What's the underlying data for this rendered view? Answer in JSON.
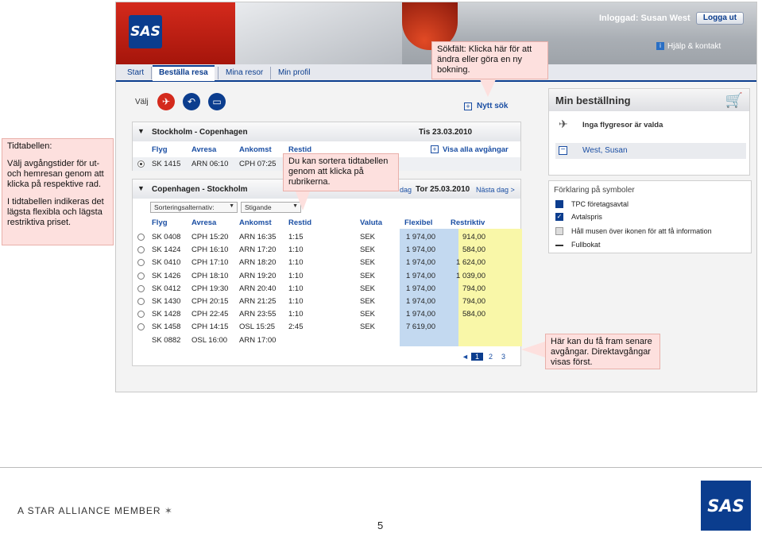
{
  "header": {
    "logo_text": "SAS",
    "user_label": "Inloggad: Susan West",
    "logout_label": "Logga ut",
    "help_label": "Hjälp & kontakt"
  },
  "tabs": [
    "Start",
    "Beställa resa",
    "Mina resor",
    "Min profil"
  ],
  "search": {
    "valj_label": "Välj",
    "new_search_label": "Nytt sök"
  },
  "outbound": {
    "route": "Stockholm - Copenhagen",
    "date": "Tis 23.03.2010",
    "columns": [
      "Flyg",
      "Avresa",
      "Ankomst",
      "Restid"
    ],
    "show_all_label": "Visa alla avgångar",
    "row": {
      "flight": "SK 1415",
      "dep": "ARN 06:10",
      "arr": "CPH 07:25"
    }
  },
  "inbound": {
    "route": "Copenhagen - Stockholm",
    "prev_day": "dag",
    "date": "Tor 25.03.2010",
    "next_day": "Nästa dag >",
    "sort_label": "Sorteringsalternativ:",
    "sort_order": "Stigande",
    "columns": [
      "Flyg",
      "Avresa",
      "Ankomst",
      "Restid",
      "Valuta",
      "Flexibel",
      "Restriktiv"
    ],
    "rows": [
      {
        "flight": "SK 0408",
        "dep": "CPH 15:20",
        "arr": "ARN 16:35",
        "dur": "1:15",
        "cur": "SEK",
        "flex": "1 974,00",
        "restr": "914,00"
      },
      {
        "flight": "SK 1424",
        "dep": "CPH 16:10",
        "arr": "ARN 17:20",
        "dur": "1:10",
        "cur": "SEK",
        "flex": "1 974,00",
        "restr": "584,00"
      },
      {
        "flight": "SK 0410",
        "dep": "CPH 17:10",
        "arr": "ARN 18:20",
        "dur": "1:10",
        "cur": "SEK",
        "flex": "1 974,00",
        "restr": "1 624,00"
      },
      {
        "flight": "SK 1426",
        "dep": "CPH 18:10",
        "arr": "ARN 19:20",
        "dur": "1:10",
        "cur": "SEK",
        "flex": "1 974,00",
        "restr": "1 039,00"
      },
      {
        "flight": "SK 0412",
        "dep": "CPH 19:30",
        "arr": "ARN 20:40",
        "dur": "1:10",
        "cur": "SEK",
        "flex": "1 974,00",
        "restr": "794,00"
      },
      {
        "flight": "SK 1430",
        "dep": "CPH 20:15",
        "arr": "ARN 21:25",
        "dur": "1:10",
        "cur": "SEK",
        "flex": "1 974,00",
        "restr": "794,00"
      },
      {
        "flight": "SK 1428",
        "dep": "CPH 22:45",
        "arr": "ARN 23:55",
        "dur": "1:10",
        "cur": "SEK",
        "flex": "1 974,00",
        "restr": "584,00"
      },
      {
        "flight": "SK 1458",
        "dep": "CPH 14:15",
        "arr": "OSL 15:25",
        "dur": "2:45",
        "cur": "SEK",
        "flex": "7 619,00",
        "restr": ""
      },
      {
        "flight": "SK 0882",
        "dep": "OSL 16:00",
        "arr": "ARN 17:00",
        "dur": "",
        "cur": "",
        "flex": "",
        "restr": ""
      }
    ],
    "pages": [
      "1",
      "2",
      "3"
    ]
  },
  "order": {
    "title": "Min beställning",
    "item1": "Inga flygresor är valda",
    "item2": "West, Susan"
  },
  "legend": {
    "title": "Förklaring på symboler",
    "items": [
      "TPC företagsavtal",
      "Avtalspris",
      "Håll musen över ikonen för att få information",
      "Fullbokat"
    ]
  },
  "callouts": {
    "sokfalt_title": "Sökfält",
    "sokfalt_text": ": Klicka här för att ändra eller göra en ny bokning.",
    "tidtabellen_title": "Tidtabellen",
    "tidtabellen_colon": ":",
    "tidtabellen_p1": "Välj avgångstider för ut- och hemresan genom att klicka på respektive  rad.",
    "tidtabellen_p2": "I tidtabellen indikeras det lägsta flexibla och lägsta restriktiva priset.",
    "sort_text": "Du kan sortera tidtabellen genom att klicka på rubrikerna.",
    "pager_text": "Här kan du få fram senare avgångar. Direktavgångar visas  först."
  },
  "footer": {
    "alliance": "A STAR ALLIANCE MEMBER",
    "page_number": "5",
    "logo_text": "SAS"
  },
  "colors": {
    "sas_blue": "#0b3d8e",
    "callout_bg": "#fde0de",
    "flex_bg": "#c3d9f0",
    "restr_bg": "#f9f7a8"
  }
}
